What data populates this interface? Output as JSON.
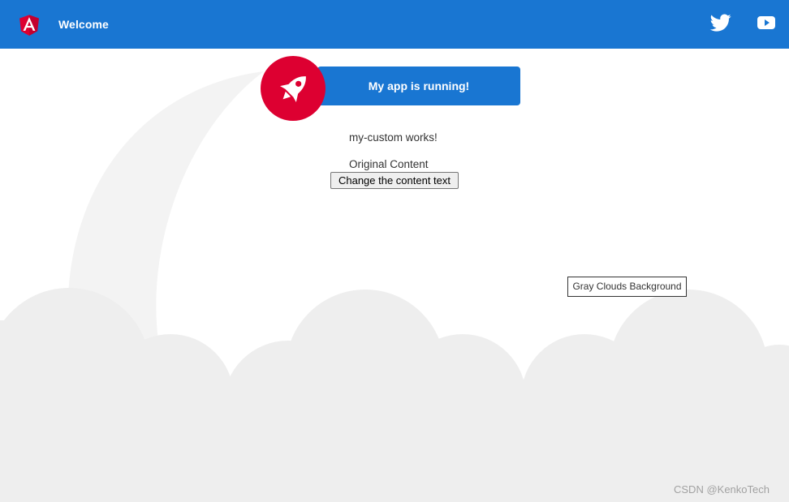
{
  "toolbar": {
    "logo_icon": "angular-logo",
    "title": "Welcome",
    "twitter_icon": "twitter-icon",
    "youtube_icon": "youtube-icon",
    "background_color": "#1976d2"
  },
  "banner": {
    "icon": "rocket-icon",
    "text": "My app is running!",
    "accent_color": "#dd0031",
    "banner_color": "#1976d2"
  },
  "content": {
    "custom_text": "my-custom works!",
    "original_text": "Original Content",
    "change_button_label": "Change the content text"
  },
  "background": {
    "clouds_label": "Gray Clouds Background",
    "cloud_color": "#eeeeee",
    "circle_color": "#f3f3f3"
  },
  "watermark": {
    "text": "CSDN @KenkoTech"
  }
}
